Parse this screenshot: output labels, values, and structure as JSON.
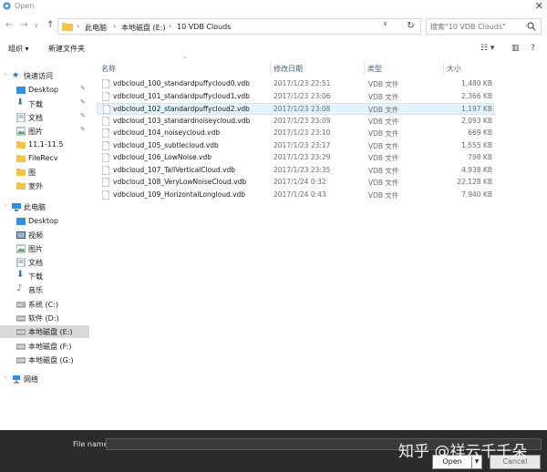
{
  "window": {
    "title": "Open"
  },
  "address": {
    "crumbs": [
      "此电脑",
      "本地磁盘 (E:)",
      "10 VDB Clouds"
    ],
    "search_placeholder": "搜索\"10 VDB Clouds\""
  },
  "toolbar": {
    "organize": "组织 ▾",
    "new_folder": "新建文件夹"
  },
  "nav": {
    "quick_access": "快速访问",
    "quick_items": [
      "Desktop",
      "下载",
      "文档",
      "图片",
      "11.1-11.5",
      "FileRecv",
      "图",
      "室外"
    ],
    "this_pc": "此电脑",
    "pc_items": [
      "Desktop",
      "视频",
      "图片",
      "文档",
      "下载",
      "音乐",
      "系统 (C:)",
      "软件 (D:)",
      "本地磁盘 (E:)",
      "本地磁盘 (F:)",
      "本地磁盘 (G:)"
    ],
    "network": "网络"
  },
  "columns": {
    "name": "名称",
    "date": "修改日期",
    "type": "类型",
    "size": "大小"
  },
  "files": [
    {
      "name": "vdbcloud_100_standardpuffycloud0.vdb",
      "date": "2017/1/23 22:51",
      "type": "VDB 文件",
      "size": "1,480 KB"
    },
    {
      "name": "vdbcloud_101_standardpuffycloud1.vdb",
      "date": "2017/1/23 23:06",
      "type": "VDB 文件",
      "size": "2,366 KB"
    },
    {
      "name": "vdbcloud_102_standardpuffycloud2.vdb",
      "date": "2017/1/23 23:08",
      "type": "VDB 文件",
      "size": "1,197 KB"
    },
    {
      "name": "vdbcloud_103_standardnoiseycloud.vdb",
      "date": "2017/1/23 23:09",
      "type": "VDB 文件",
      "size": "2,093 KB"
    },
    {
      "name": "vdbcloud_104_noiseycloud.vdb",
      "date": "2017/1/23 23:10",
      "type": "VDB 文件",
      "size": "669 KB"
    },
    {
      "name": "vdbcloud_105_subtlecloud.vdb",
      "date": "2017/1/23 23:17",
      "type": "VDB 文件",
      "size": "1,555 KB"
    },
    {
      "name": "vdbcloud_106_LowNoise.vdb",
      "date": "2017/1/23 23:29",
      "type": "VDB 文件",
      "size": "798 KB"
    },
    {
      "name": "vdbcloud_107_TallVerticalCloud.vdb",
      "date": "2017/1/23 23:35",
      "type": "VDB 文件",
      "size": "4,938 KB"
    },
    {
      "name": "vdbcloud_108_VeryLowNoiseCloud.vdb",
      "date": "2017/1/24 0:32",
      "type": "VDB 文件",
      "size": "22,128 KB"
    },
    {
      "name": "vdbcloud_109_HorizontalLongloud.vdb",
      "date": "2017/1/24 0:43",
      "type": "VDB 文件",
      "size": "7,940 KB"
    }
  ],
  "footer": {
    "file_name_label": "File name:",
    "file_name_value": "",
    "open": "Open",
    "cancel": "Cancel"
  },
  "watermark": "知乎 @祥云千千朵",
  "colors": {
    "selected_row": "#e5f3ff",
    "footer_bg": "#2b2b2b",
    "folder_yellow": "#f5c542",
    "accent_blue": "#1e6fd9"
  }
}
